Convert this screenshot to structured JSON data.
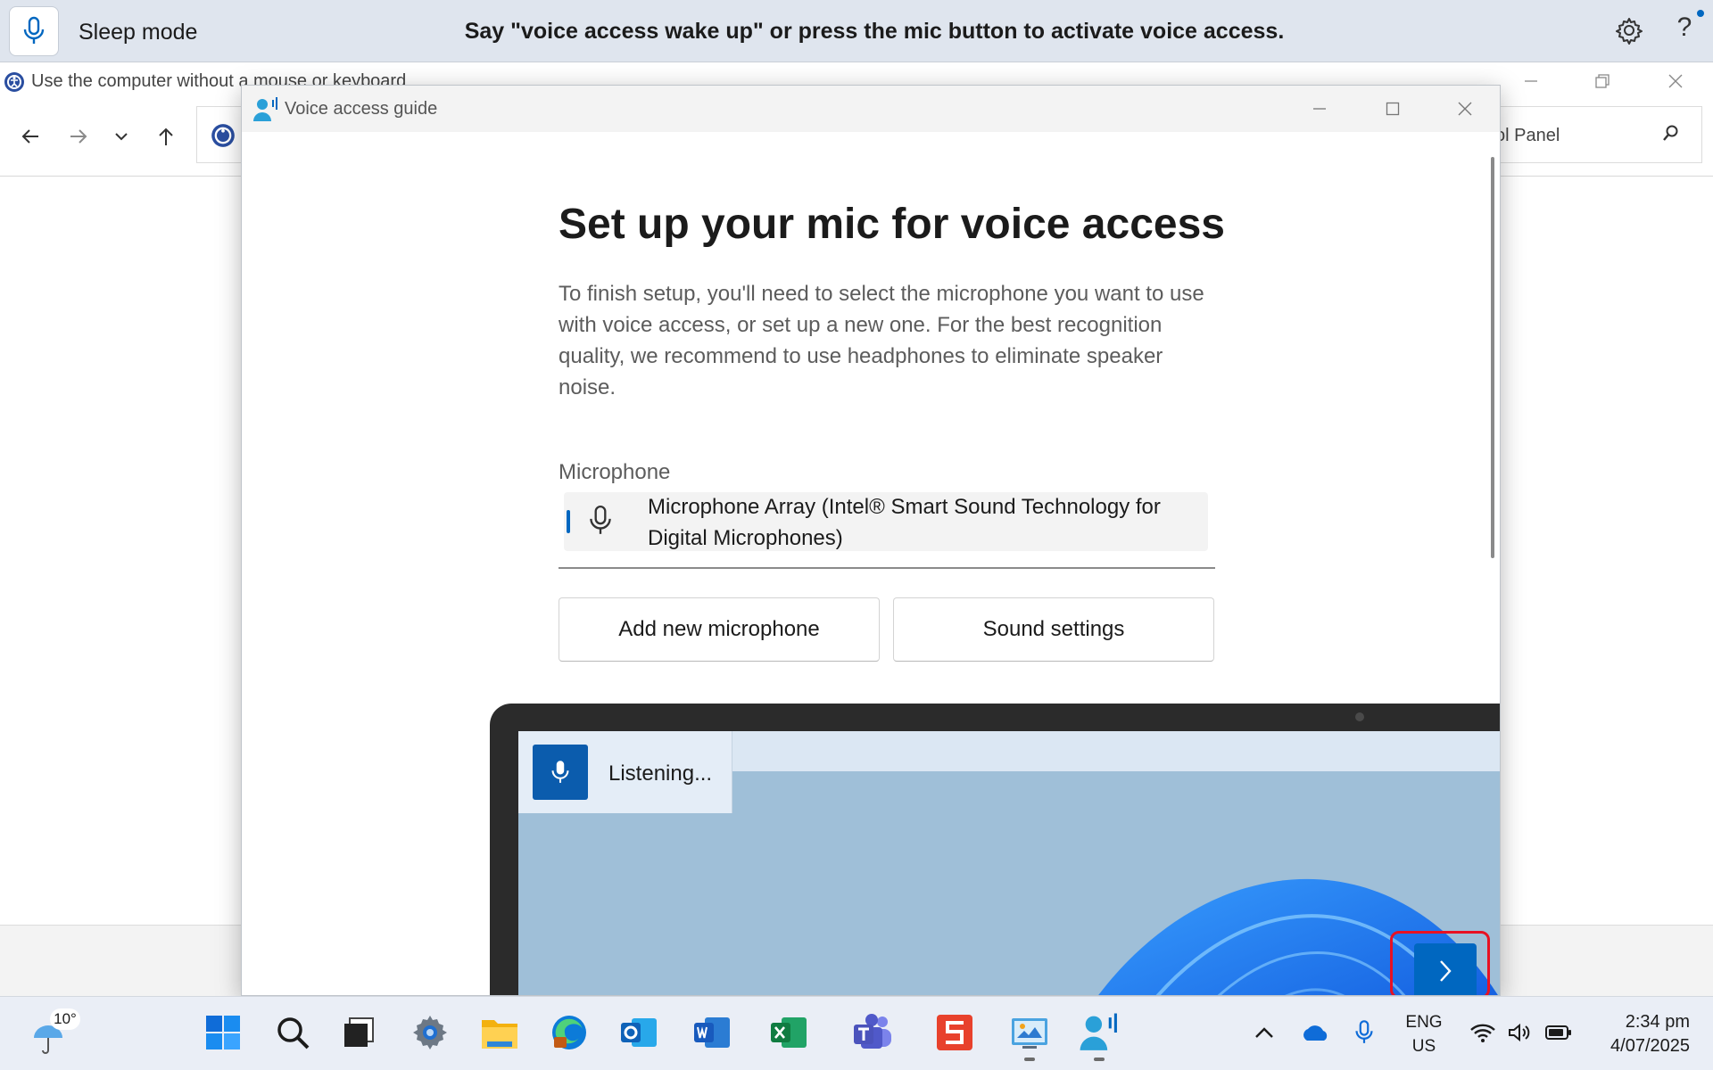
{
  "voice_access_bar": {
    "mode": "Sleep mode",
    "message": "Say \"voice access wake up\" or press the mic button to activate voice access.",
    "help_label": "?",
    "accent_color": "#0067c0"
  },
  "background_window": {
    "title": "Use the computer without a mouse or keyboard",
    "search_text": "ol Panel"
  },
  "dialog": {
    "title": "Voice access guide",
    "heading": "Set up your mic for voice access",
    "description": "To finish setup, you'll need to select the microphone you want to use with voice access, or set up a new one. For the best recognition quality, we recommend to use headphones to eliminate speaker noise.",
    "microphone_label": "Microphone",
    "microphone_value": "Microphone Array (Intel® Smart Sound Technology for Digital Microphones)",
    "add_microphone_label": "Add new microphone",
    "sound_settings_label": "Sound settings",
    "illustration_listening": "Listening...",
    "next_highlight_color": "#e81123"
  },
  "taskbar": {
    "weather_temp": "10°",
    "pinned_apps": [
      "start-icon",
      "search-icon",
      "task-view-icon",
      "settings-icon",
      "file-explorer-icon",
      "edge-icon",
      "outlook-icon",
      "word-icon",
      "excel-icon",
      "teams-icon",
      "wps-icon",
      "control-panel-icon",
      "voice-access-icon"
    ],
    "language_top": "ENG",
    "language_bottom": "US",
    "time": "2:34 pm",
    "date": "4/07/2025"
  }
}
